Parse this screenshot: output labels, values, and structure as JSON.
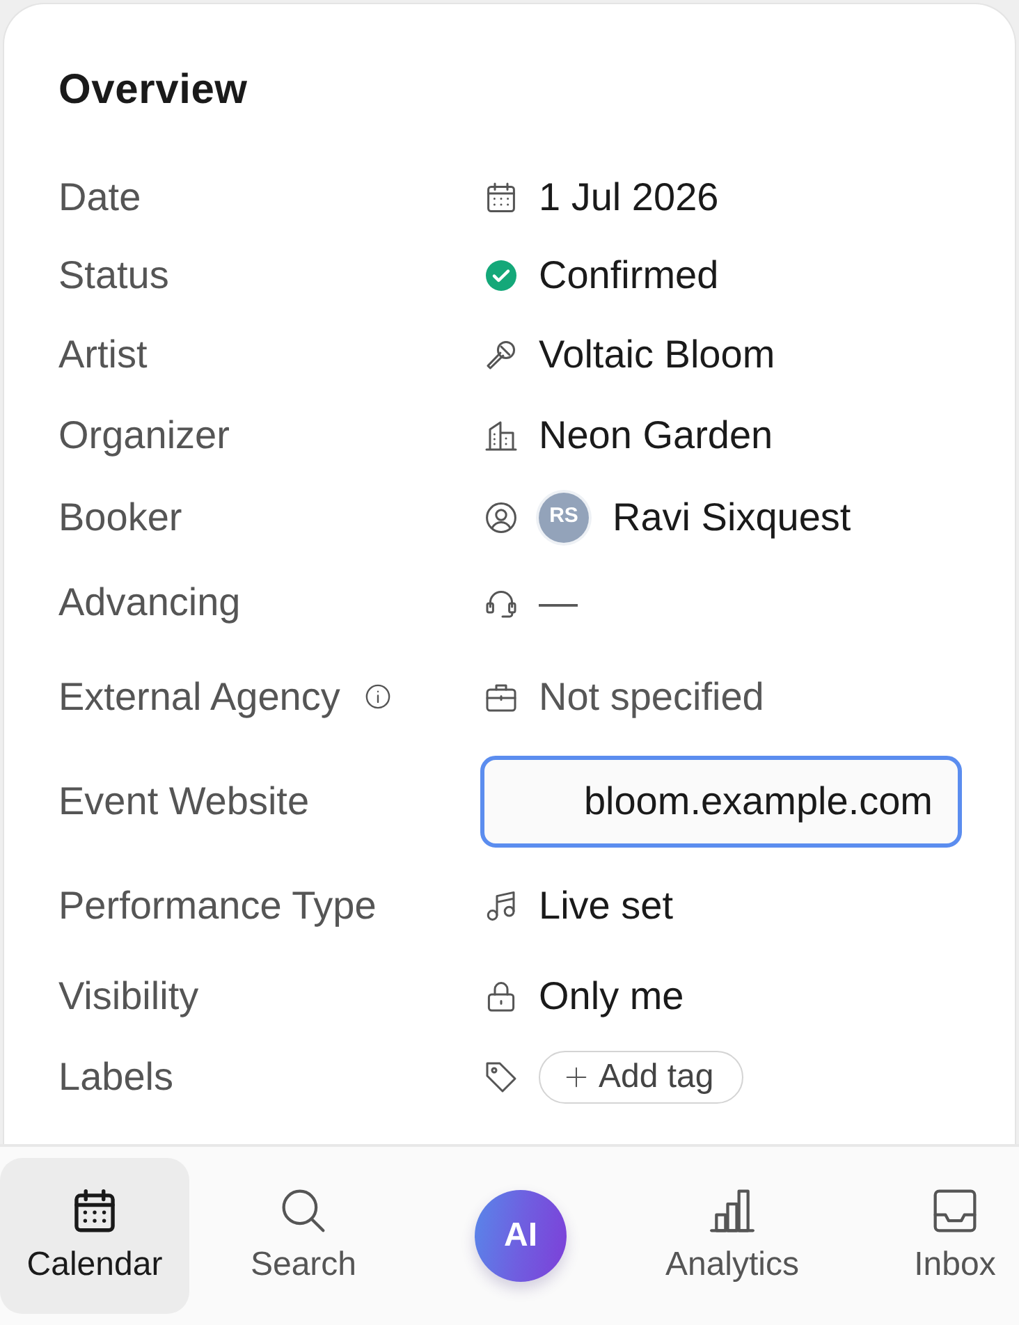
{
  "card": {
    "title": "Overview"
  },
  "fields": [
    {
      "kind": "date",
      "label": "Date",
      "value": "1 Jul 2026",
      "empty": false
    },
    {
      "kind": "status",
      "label": "Status",
      "value": "Confirmed",
      "empty": false
    },
    {
      "kind": "artist",
      "label": "Artist",
      "value": "Voltaic Bloom",
      "empty": false
    },
    {
      "kind": "organizer",
      "label": "Organizer",
      "value": "Neon Garden",
      "empty": false
    },
    {
      "kind": "person",
      "label": "Booker",
      "value": "Ravi Sixquest",
      "initials": "RS",
      "empty": false
    },
    {
      "kind": "contact",
      "label": "Advancing",
      "value": "—",
      "empty": true
    },
    {
      "kind": "agency",
      "label": "External Agency",
      "value": "Not specified",
      "empty": true,
      "info": true
    },
    {
      "kind": "website",
      "label": "Event Website",
      "value": "bloom.example.com",
      "focused": true
    },
    {
      "kind": "performance",
      "label": "Performance Type",
      "value": "Live set",
      "empty": false
    },
    {
      "kind": "visibility",
      "label": "Visibility",
      "value": "Only me",
      "empty": false
    },
    {
      "kind": "tags",
      "label": "Labels",
      "button": "Add tag"
    }
  ],
  "bottom_nav": [
    {
      "kind": "calendar",
      "label": "Calendar",
      "selected": true
    },
    {
      "kind": "search",
      "label": "Search",
      "selected": false
    },
    {
      "kind": "assistant",
      "label": "AI",
      "selected": false
    },
    {
      "kind": "analytics",
      "label": "Analytics",
      "selected": false
    },
    {
      "kind": "inbox",
      "label": "Inbox",
      "selected": false
    }
  ]
}
